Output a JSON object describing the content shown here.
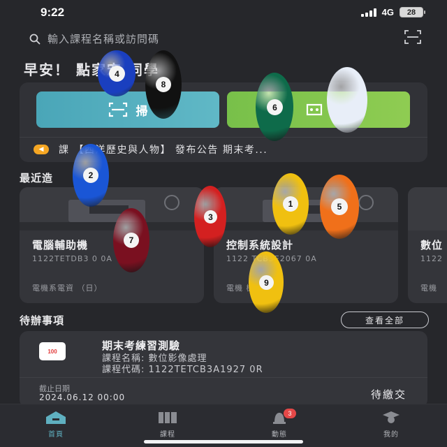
{
  "status": {
    "time": "9:22",
    "network": "4G",
    "battery": "28"
  },
  "search": {
    "placeholder": "輸入課程名稱或訪問碼"
  },
  "greeting": "早安！ 點家宏 同學",
  "actions": {
    "scan_label": "掃",
    "code_label": ""
  },
  "notice": {
    "text": "課 【西洋歷史與人物】 發布公告 期末考..."
  },
  "sections": {
    "recent": "最近造",
    "todo": "待辦事項",
    "view_all": "查看全部"
  },
  "courses": [
    {
      "name": "電腦輔助機",
      "code": "1122TETDB3 0 0A",
      "teacher": "電機系電資 （日）"
    },
    {
      "name": "控制系統設計",
      "code": "1122 TCB3E2067 0A",
      "teacher": "電機 機 （日）"
    },
    {
      "name": "數位",
      "code": "1122",
      "teacher": "電機"
    }
  ],
  "todo": {
    "title": "期末考練習測驗",
    "course_name": "課程名稱: 數位影像處理",
    "course_code": "課程代碼: 1122TETCB3A1927 0R",
    "due_label": "截止日期",
    "due_value": "2024.06.12 00:00",
    "status": "待繳交",
    "icon_text": "100"
  },
  "tabs": [
    {
      "label": "首頁",
      "icon": "home-icon",
      "active": true
    },
    {
      "label": "課程",
      "icon": "book-icon",
      "active": false
    },
    {
      "label": "動態",
      "icon": "bell-icon",
      "active": false,
      "badge": "3"
    },
    {
      "label": "我的",
      "icon": "graduate-icon",
      "active": false
    }
  ],
  "balls": [
    {
      "number": "4",
      "color": "#1a3fbf"
    },
    {
      "number": "8",
      "color": "#111111"
    },
    {
      "number": "6",
      "color": "#0e6b4a"
    },
    {
      "number": "",
      "color": "#e8eef8"
    },
    {
      "number": "2",
      "color": "#1a56d6"
    },
    {
      "number": "3",
      "color": "#d42020"
    },
    {
      "number": "1",
      "color": "#f0c010"
    },
    {
      "number": "5",
      "color": "#f0701a"
    },
    {
      "number": "7",
      "color": "#7a1020"
    },
    {
      "number": "9",
      "color": "#f0c010"
    }
  ],
  "colors": {
    "accent": "#5fb0c0",
    "scan_btn": "#4aa6b8",
    "code_btn": "#8fcc52",
    "badge": "#e54848"
  }
}
